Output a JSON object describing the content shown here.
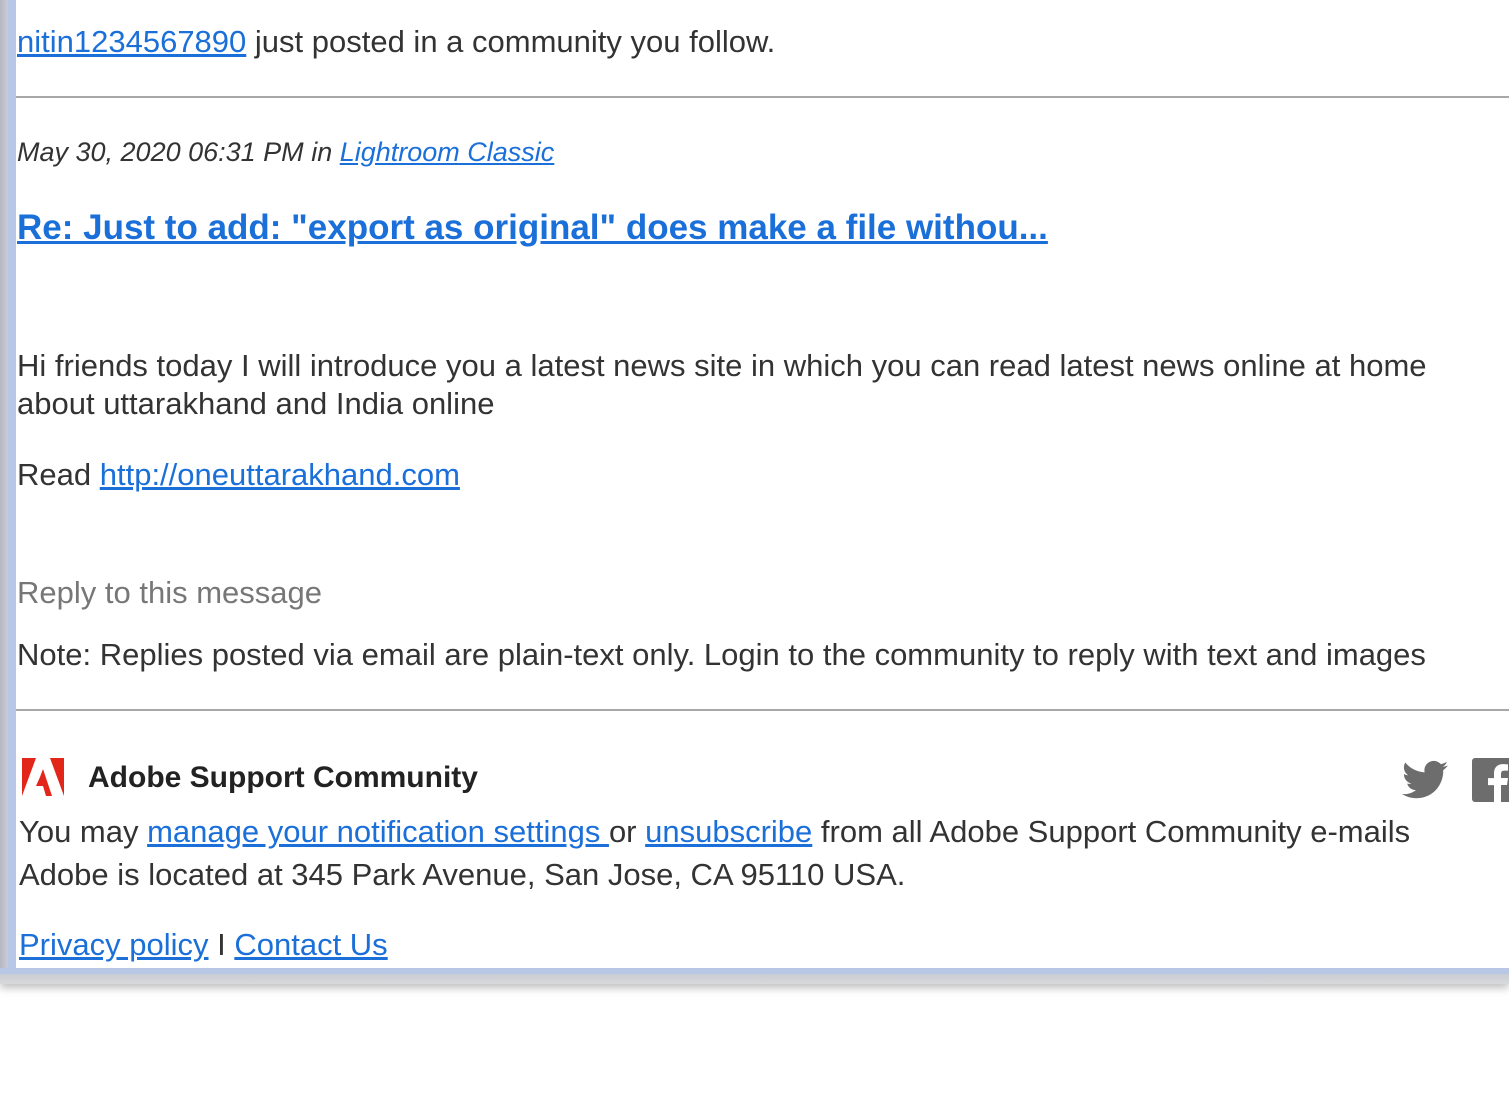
{
  "post": {
    "author": "nitin1234567890",
    "intro_text": " just posted in a community you follow.",
    "date": "May 30, 2020 06:31 PM",
    "in_text": " in ",
    "community": "Lightroom Classic",
    "title": "Re: Just to add: \"export as original\" does make a file withou...",
    "body_line1": "Hi friends today I will introduce you a latest news site in which you can read latest news online at home",
    "body_line2": "about uttarakhand and India online",
    "read_label": "Read ",
    "read_link": "http://oneuttarakhand.com "
  },
  "reply": {
    "label": "Reply to this message",
    "note": "Note: Replies posted via email are plain-text only. Login to the community to reply with text and images"
  },
  "footer": {
    "brand": "Adobe Support Community",
    "manage_prefix": "You may ",
    "manage_link": "manage your notification settings ",
    "manage_or": "or ",
    "unsubscribe_link": "unsubscribe",
    "manage_suffix": " from all Adobe Support Community e-mails",
    "address": "Adobe is located at 345 Park Avenue, San Jose, CA 95110 USA.",
    "privacy_link": "Privacy policy",
    "separator": " I ",
    "contact_link": "Contact Us",
    "icons": [
      "adobe-logo-icon",
      "twitter-icon",
      "facebook-icon"
    ],
    "brand_color": "#e3261a"
  }
}
